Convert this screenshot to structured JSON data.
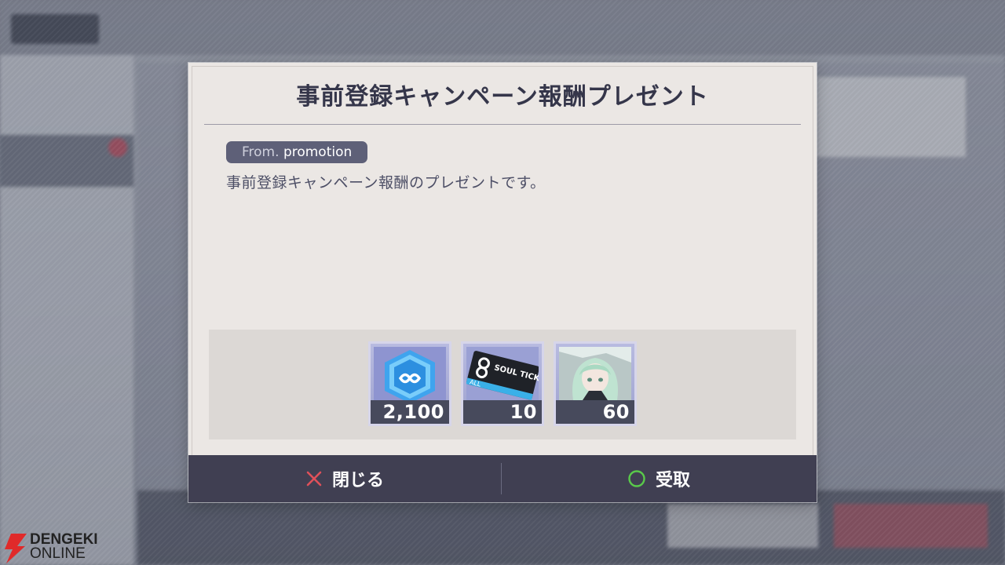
{
  "dialog": {
    "title": "事前登録キャンペーン報酬プレゼント",
    "from_prefix": "From.",
    "from_value": "promotion",
    "message": "事前登録キャンペーン報酬のプレゼントです。"
  },
  "rewards": [
    {
      "icon": "crystal-icon",
      "count": "2,100"
    },
    {
      "icon": "soul-ticket-icon",
      "count": "10",
      "ticket_text": "SOUL TICKET",
      "ticket_sub": "ALL"
    },
    {
      "icon": "character-portrait-icon",
      "count": "60"
    }
  ],
  "buttons": {
    "close_label": "閉じる",
    "receive_label": "受取"
  },
  "watermark": {
    "line1": "DENGEKI",
    "line2": "ONLINE"
  },
  "colors": {
    "dialog_bg": "#ebe7e4",
    "title": "#35364a",
    "footer": "#403f52",
    "close_icon": "#e0505a",
    "receive_icon": "#59c94a",
    "count_bg": "#474a5c"
  }
}
